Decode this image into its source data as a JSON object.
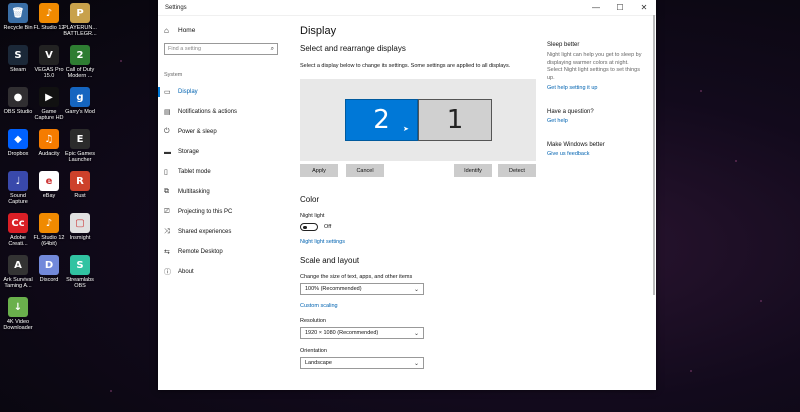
{
  "desktop": {
    "icons": [
      {
        "label": "Recycle Bin",
        "glyph": "🗑",
        "color": "#3a6ea5"
      },
      {
        "label": "FL Studio 12",
        "glyph": "♪",
        "color": "#f08a00"
      },
      {
        "label": "PLAYERUN...\nBATTLEGR...",
        "glyph": "P",
        "color": "#c8a14b"
      },
      {
        "label": "Steam",
        "glyph": "S",
        "color": "#1b2838"
      },
      {
        "label": "VEGAS Pro\n15.0",
        "glyph": "V",
        "color": "#222"
      },
      {
        "label": "Call of Duty\nModern ...",
        "glyph": "2",
        "color": "#2e7d32"
      },
      {
        "label": "OBS Studio",
        "glyph": "●",
        "color": "#302e31"
      },
      {
        "label": "Game\nCapture HD",
        "glyph": "▶",
        "color": "#111"
      },
      {
        "label": "Garry's Mod",
        "glyph": "g",
        "color": "#1565c0"
      },
      {
        "label": "Dropbox",
        "glyph": "◆",
        "color": "#0061fe"
      },
      {
        "label": "Audacity",
        "glyph": "♫",
        "color": "#f57c00"
      },
      {
        "label": "Epic Games\nLauncher",
        "glyph": "E",
        "color": "#2b2b2b"
      },
      {
        "label": "Sound\nCapture",
        "glyph": "♩",
        "color": "#3949ab"
      },
      {
        "label": "eBay",
        "glyph": "e",
        "color": "#fff"
      },
      {
        "label": "Rust",
        "glyph": "R",
        "color": "#cd412b"
      },
      {
        "label": "Adobe\nCreati...",
        "glyph": "Cc",
        "color": "#da1f26"
      },
      {
        "label": "FL Studio 12\n(64bit)",
        "glyph": "♪",
        "color": "#f08a00"
      },
      {
        "label": "Insmight",
        "glyph": "▢",
        "color": "#e0e0e0"
      },
      {
        "label": "Ark Survival\nTaming A...",
        "glyph": "A",
        "color": "#333"
      },
      {
        "label": "Discord",
        "glyph": "D",
        "color": "#7289da"
      },
      {
        "label": "Streamlabs\nOBS",
        "glyph": "S",
        "color": "#31c3a2"
      },
      {
        "label": "4K Video\nDownloader",
        "glyph": "↓",
        "color": "#6ab04c"
      }
    ]
  },
  "window": {
    "title": "Settings",
    "min": "—",
    "max": "☐",
    "close": "✕"
  },
  "sidebar": {
    "home_icon": "⌂",
    "home": "Home",
    "search_placeholder": "Find a setting",
    "search_icon": "⌕",
    "section": "System",
    "items": [
      {
        "label": "Display",
        "icon": "▭"
      },
      {
        "label": "Notifications & actions",
        "icon": "▤"
      },
      {
        "label": "Power & sleep",
        "icon": "⏻"
      },
      {
        "label": "Storage",
        "icon": "▬"
      },
      {
        "label": "Tablet mode",
        "icon": "▯"
      },
      {
        "label": "Multitasking",
        "icon": "⧉"
      },
      {
        "label": "Projecting to this PC",
        "icon": "⎚"
      },
      {
        "label": "Shared experiences",
        "icon": "⤨"
      },
      {
        "label": "Remote Desktop",
        "icon": "⇆"
      },
      {
        "label": "About",
        "icon": "ⓘ"
      }
    ]
  },
  "main": {
    "title": "Display",
    "select_heading": "Select and rearrange displays",
    "select_desc": "Select a display below to change its settings. Some settings are applied to all displays.",
    "monitor_2": "2",
    "monitor_1": "1",
    "buttons": {
      "apply": "Apply",
      "cancel": "Cancel",
      "identify": "Identify",
      "detect": "Detect"
    },
    "color_heading": "Color",
    "night_light_label": "Night light",
    "night_light_state": "Off",
    "night_light_link": "Night light settings",
    "scale_heading": "Scale and layout",
    "scale_label": "Change the size of text, apps, and other items",
    "scale_value": "100% (Recommended)",
    "custom_scaling": "Custom scaling",
    "resolution_label": "Resolution",
    "resolution_value": "1920 × 1080 (Recommended)",
    "orientation_label": "Orientation",
    "orientation_value": "Landscape",
    "chevron": "⌄"
  },
  "right": {
    "sleep_heading": "Sleep better",
    "sleep_text": "Night light can help you get to sleep by displaying warmer colors at night. Select Night light settings to set things up.",
    "sleep_link": "Get help setting it up",
    "question_heading": "Have a question?",
    "help_link": "Get help",
    "better_heading": "Make Windows better",
    "feedback_link": "Give us feedback"
  }
}
